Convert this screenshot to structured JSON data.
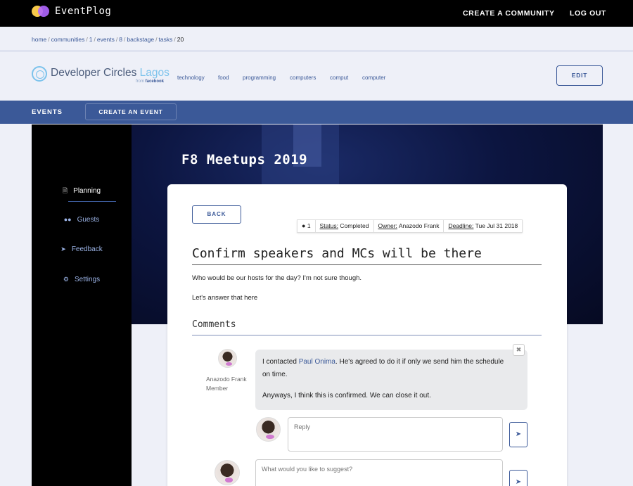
{
  "app": {
    "brand": "EventPlog"
  },
  "topnav": {
    "create_community": "CREATE A COMMUNITY",
    "logout": "LOG OUT"
  },
  "breadcrumb": [
    "home",
    "communities",
    "1",
    "events",
    "8",
    "backstage",
    "tasks",
    "20"
  ],
  "community": {
    "name_main": "Developer Circles",
    "name_city": "Lagos",
    "from_prefix": "from",
    "from_brand": "facebook",
    "tags": [
      "technology",
      "food",
      "programming",
      "computers",
      "comput",
      "computer"
    ],
    "edit_label": "EDIT"
  },
  "events_bar": {
    "label": "EVENTS",
    "create_label": "CREATE AN EVENT"
  },
  "sidebar": {
    "items": [
      {
        "label": "Planning",
        "icon": "document-icon",
        "active": true
      },
      {
        "label": "Guests",
        "icon": "users-icon"
      },
      {
        "label": "Feedback",
        "icon": "paper-plane-icon"
      },
      {
        "label": "Settings",
        "icon": "gears-icon"
      }
    ]
  },
  "event": {
    "title": "F8 Meetups 2019"
  },
  "task": {
    "back_label": "BACK",
    "comment_count": "1",
    "status_label": "Status:",
    "status_value": "Completed",
    "owner_label": "Owner:",
    "owner_value": "Anazodo Frank",
    "deadline_label": "Deadline:",
    "deadline_value": "Tue Jul 31 2018",
    "title": "Confirm speakers and MCs will be there",
    "description": [
      "Who would be our hosts for the day? I'm not sure though.",
      "Let's answer that here"
    ]
  },
  "comments": {
    "heading": "Comments",
    "items": [
      {
        "author": "Anazodo Frank",
        "role": "Member",
        "text_before_link": "I contacted ",
        "link_text": "Paul Onima",
        "text_after_link": ". He's agreed to do it if only we send him the schedule on time.",
        "text_2": "Anyways, I think this is confirmed. We can close it out."
      }
    ],
    "reply_placeholder": "Reply",
    "suggest_placeholder": "What would you like to suggest?"
  },
  "colors": {
    "accent": "#3b5998",
    "topbar": "#000000",
    "page_bg": "#eef0f8",
    "logo_light": "#7cc3ec"
  }
}
